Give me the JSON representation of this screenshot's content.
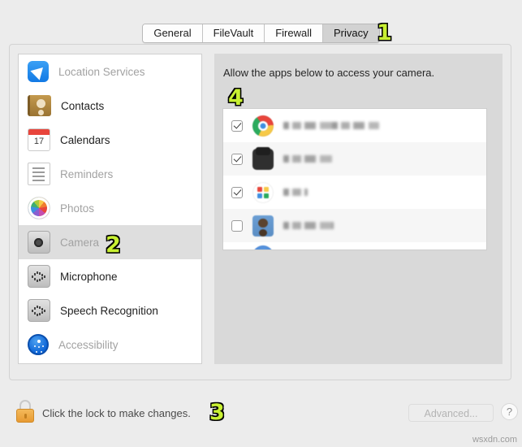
{
  "window": {
    "tabs": [
      {
        "label": "General",
        "selected": false
      },
      {
        "label": "FileVault",
        "selected": false
      },
      {
        "label": "Firewall",
        "selected": false
      },
      {
        "label": "Privacy",
        "selected": true
      }
    ]
  },
  "sidebar": {
    "items": [
      {
        "label": "Location Services",
        "icon": "location-arrow-icon",
        "dimmed": true,
        "selected": false
      },
      {
        "label": "Contacts",
        "icon": "contacts-book-icon",
        "dimmed": false,
        "selected": false
      },
      {
        "label": "Calendars",
        "icon": "calendar-icon",
        "dimmed": false,
        "selected": false
      },
      {
        "label": "Reminders",
        "icon": "reminders-list-icon",
        "dimmed": true,
        "selected": false
      },
      {
        "label": "Photos",
        "icon": "photos-pinwheel-icon",
        "dimmed": true,
        "selected": false
      },
      {
        "label": "Camera",
        "icon": "camera-icon",
        "dimmed": true,
        "selected": true
      },
      {
        "label": "Microphone",
        "icon": "microphone-wave-icon",
        "dimmed": false,
        "selected": false
      },
      {
        "label": "Speech Recognition",
        "icon": "speech-wave-icon",
        "dimmed": false,
        "selected": false
      },
      {
        "label": "Accessibility",
        "icon": "accessibility-icon",
        "dimmed": true,
        "selected": false
      }
    ]
  },
  "right_pane": {
    "description": "Allow the apps below to access your camera.",
    "apps": [
      {
        "name": "",
        "icon": "chrome-icon",
        "checked": true,
        "name_redacted": true
      },
      {
        "name": "",
        "icon": "dark-app-icon",
        "checked": true,
        "name_redacted": true
      },
      {
        "name": "",
        "icon": "slack-icon",
        "checked": true,
        "name_redacted": true
      },
      {
        "name": "",
        "icon": "person-photo-icon",
        "checked": false,
        "name_redacted": true
      },
      {
        "name": "",
        "icon": "blue-app-icon",
        "checked": false,
        "name_redacted": true
      }
    ]
  },
  "footer": {
    "lock_icon": "closed-padlock-icon",
    "lock_text": "Click the lock to make changes.",
    "advanced_label": "Advanced...",
    "help_label": "?"
  },
  "annotations": {
    "one": "1",
    "two": "2",
    "three": "3",
    "four": "4",
    "accent_color": "#c8f032"
  },
  "watermark": "wsxdn.com"
}
